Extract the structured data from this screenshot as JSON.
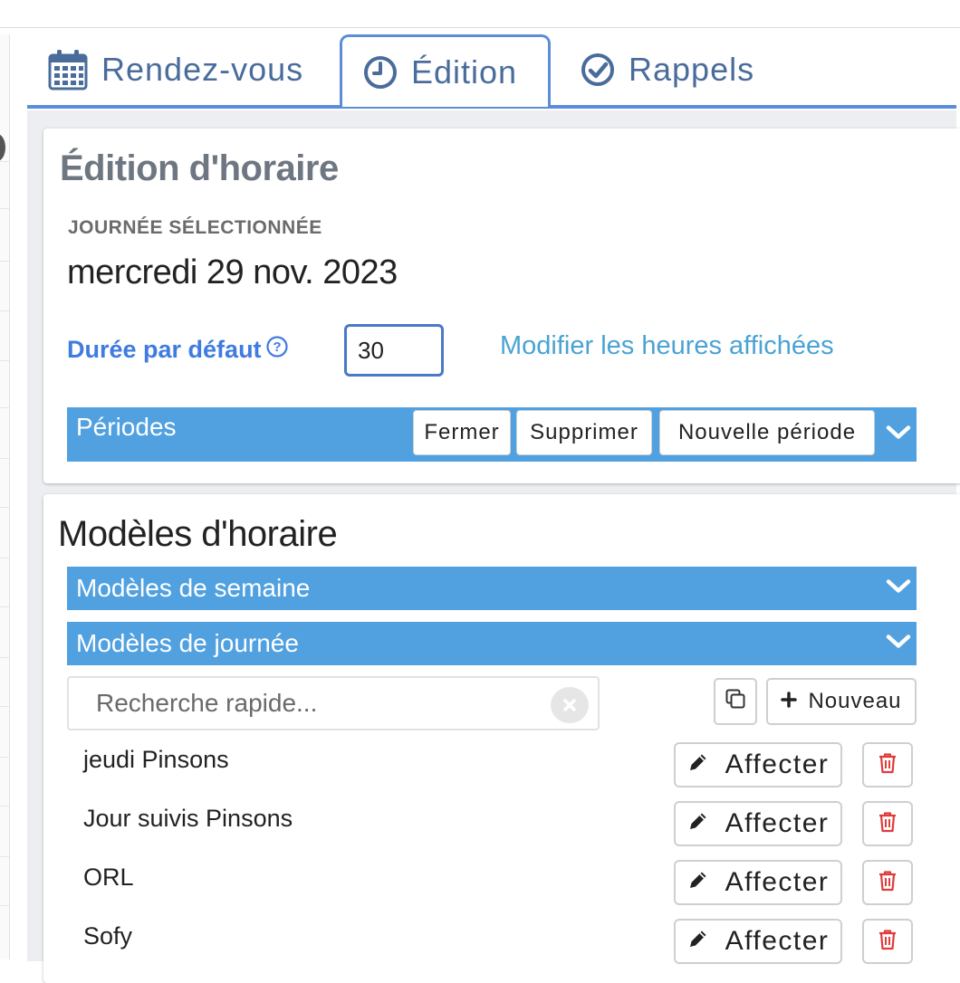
{
  "tabs": [
    {
      "label": "Rendez-vous",
      "icon": "calendar-icon"
    },
    {
      "label": "Édition",
      "icon": "clock-icon",
      "active": true
    },
    {
      "label": "Rappels",
      "icon": "check-circle-icon"
    }
  ],
  "edition": {
    "title": "Édition d'horaire",
    "selected_day_label": "JOURNÉE SÉLECTIONNÉE",
    "selected_day_value": "mercredi 29 nov. 2023",
    "duration_label": "Durée par défaut",
    "duration_value": "30",
    "modify_link": "Modifier les heures affichées"
  },
  "periods": {
    "title": "Périodes",
    "buttons": {
      "close": "Fermer",
      "delete": "Supprimer",
      "new": "Nouvelle période"
    }
  },
  "models": {
    "title": "Modèles d'horaire",
    "week_section": "Modèles de semaine",
    "day_section": "Modèles de journée",
    "search_placeholder": "Recherche rapide...",
    "new_button": "Nouveau",
    "assign_label": "Affecter",
    "items": [
      "jeudi Pinsons",
      "Jour suivis Pinsons",
      "ORL",
      "Sofy"
    ]
  },
  "colors": {
    "accent": "#51a1e0",
    "tab_border": "#5b8ed8",
    "link": "#4aa3d4",
    "duration_label": "#3f7be0",
    "delete": "#e03c3c"
  }
}
